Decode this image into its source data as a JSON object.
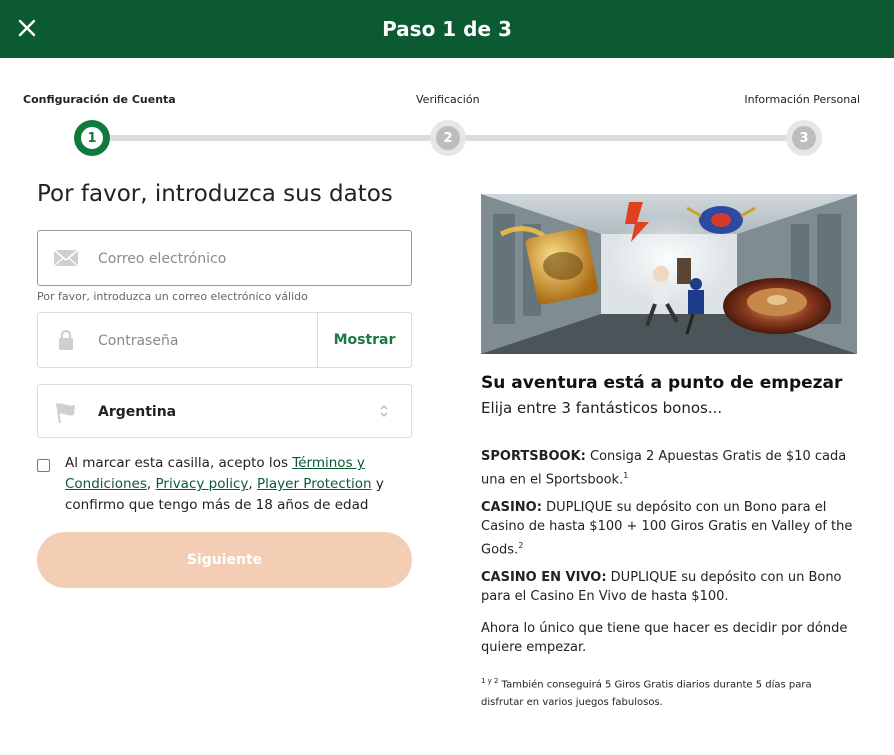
{
  "header": {
    "title": "Paso 1 de 3",
    "close_icon": "close-icon",
    "background": "#0b5a32"
  },
  "stepper": {
    "steps": [
      {
        "label": "Configuración de Cuenta",
        "number": "1",
        "state": "active"
      },
      {
        "label": "Verificación",
        "number": "2",
        "state": "pending"
      },
      {
        "label": "Información Personal",
        "number": "3",
        "state": "pending"
      }
    ],
    "accent": "#0f7a3c"
  },
  "form": {
    "heading": "Por favor, introduzca sus datos",
    "email": {
      "placeholder": "Correo electrónico",
      "value": "",
      "icon": "envelope-icon"
    },
    "email_hint": "Por favor, introduzca un correo electrónico válido",
    "password": {
      "placeholder": "Contraseña",
      "value": "",
      "icon": "lock-icon",
      "show_label": "Mostrar"
    },
    "country": {
      "value": "Argentina",
      "icon": "flag-icon"
    },
    "consent": {
      "checked": false,
      "prefix": "Al marcar esta casilla, acepto los ",
      "link_terms": "Términos y Condiciones",
      "sep1": ", ",
      "link_privacy": "Privacy policy",
      "sep2": ", ",
      "link_protection": "Player Protection",
      "suffix": " y confirmo que tengo más de 18 años de edad"
    },
    "next_button": "Siguiente",
    "next_button_color": "#f4cdb5"
  },
  "promo": {
    "title": "Su aventura está a punto de empezar",
    "subtitle": "Elija entre 3 fantásticos bonos...",
    "bonuses": [
      {
        "label": "SPORTSBOOK:",
        "text": " Consiga 2 Apuestas Gratis de $10 cada una en el Sportsbook.",
        "sup": "1"
      },
      {
        "label": "CASINO:",
        "text": " DUPLIQUE su depósito con un Bono para el Casino de hasta $100 + 100 Giros Gratis en Valley of the Gods.",
        "sup": "2"
      },
      {
        "label": "CASINO EN VIVO:",
        "text": " DUPLIQUE su depósito con un Bono para el Casino En Vivo de hasta $100.",
        "sup": ""
      }
    ],
    "closing": "Ahora lo único que tiene que hacer es decidir por dónde quiere empezar.",
    "footnote_sup": "1 y 2",
    "footnote": " También conseguirá 5 Giros Gratis diarios durante 5 días para disfrutar en varios juegos fabulosos."
  }
}
